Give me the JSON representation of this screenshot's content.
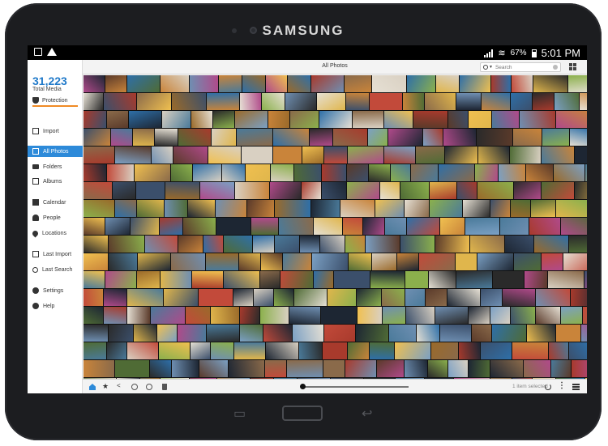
{
  "device": {
    "brand": "SAMSUNG"
  },
  "status_bar": {
    "battery": "67%",
    "time": "5:01 PM"
  },
  "sidebar": {
    "total_count": "31,223",
    "total_label": "Total Media",
    "protection_label": "Protection",
    "items": [
      {
        "label": "Import",
        "icon": "import-icon"
      },
      {
        "label": "All Photos",
        "icon": "photos-icon",
        "active": true
      },
      {
        "label": "Folders",
        "icon": "folder-icon"
      },
      {
        "label": "Albums",
        "icon": "album-icon"
      },
      {
        "label": "Calendar",
        "icon": "calendar-icon"
      },
      {
        "label": "People",
        "icon": "person-icon"
      },
      {
        "label": "Locations",
        "icon": "location-pin-icon"
      },
      {
        "label": "Last Import",
        "icon": "last-import-icon"
      },
      {
        "label": "Last Search",
        "icon": "search-icon"
      },
      {
        "label": "Settings",
        "icon": "gear-icon"
      },
      {
        "label": "Help",
        "icon": "help-icon"
      }
    ]
  },
  "topbar": {
    "title": "All Photos",
    "search_placeholder": "Search"
  },
  "bottombar": {
    "selection_text": "1 item selected"
  },
  "colors": {
    "accent": "#2d8ad9",
    "protection_underline": "#f08a24",
    "total_media": "#1f79c9"
  },
  "photo_palette": [
    "#3b4f6b",
    "#c9843a",
    "#1d2633",
    "#6f8fb2",
    "#e0b64c",
    "#4f6b35",
    "#a83a2c",
    "#8a6a4a",
    "#2e6fa8",
    "#d9d0c2",
    "#5a3a2a",
    "#b04a8a",
    "#7ba0c4",
    "#f0c050",
    "#2a2a2a",
    "#8bb04c",
    "#c24a3a",
    "#e6e0d4",
    "#4a7a9a",
    "#9a6a2a"
  ]
}
